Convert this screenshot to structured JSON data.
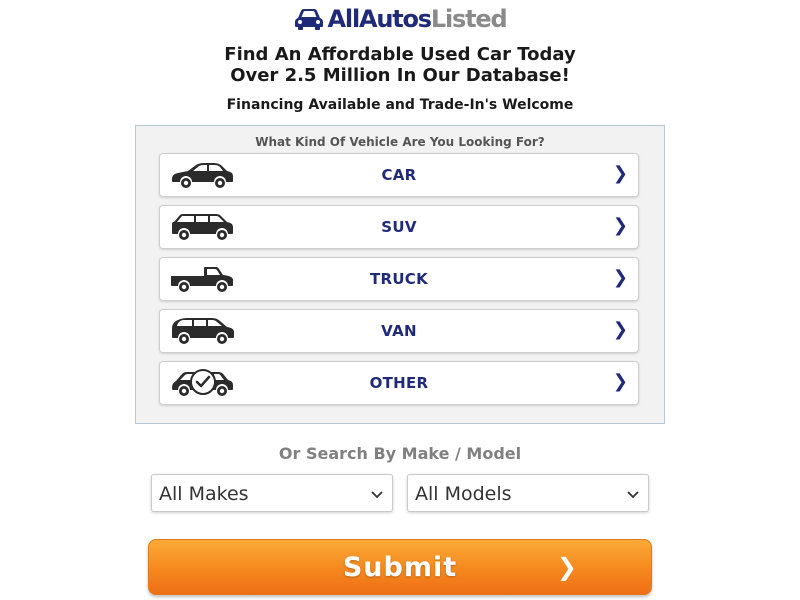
{
  "brand": {
    "logo_part1": "AllAutos",
    "logo_part2": "Listed",
    "logo_icon": "car-icon",
    "primary_color": "#1f2a78",
    "secondary_color": "#8a8a8a"
  },
  "header": {
    "headline_line1": "Find An Affordable Used Car Today",
    "headline_line2": "Over 2.5 Million In Our Database!",
    "subheadline": "Financing Available and Trade-In's Welcome"
  },
  "vehicle_panel": {
    "title": "What Kind Of Vehicle Are You Looking For?",
    "options": [
      {
        "label": "CAR",
        "icon": "sedan-icon",
        "chevron": "❯"
      },
      {
        "label": "SUV",
        "icon": "suv-icon",
        "chevron": "❯"
      },
      {
        "label": "TRUCK",
        "icon": "truck-icon",
        "chevron": "❯"
      },
      {
        "label": "VAN",
        "icon": "van-icon",
        "chevron": "❯"
      },
      {
        "label": "OTHER",
        "icon": "car-checkmark-icon",
        "chevron": "❯"
      }
    ]
  },
  "search": {
    "title": "Or Search By Make / Model",
    "makes_value": "All Makes",
    "models_value": "All Models",
    "chevron_icon": "chevron-down-icon"
  },
  "submit": {
    "label": "Submit",
    "chevron": "❯",
    "color": "#f58b1f"
  }
}
